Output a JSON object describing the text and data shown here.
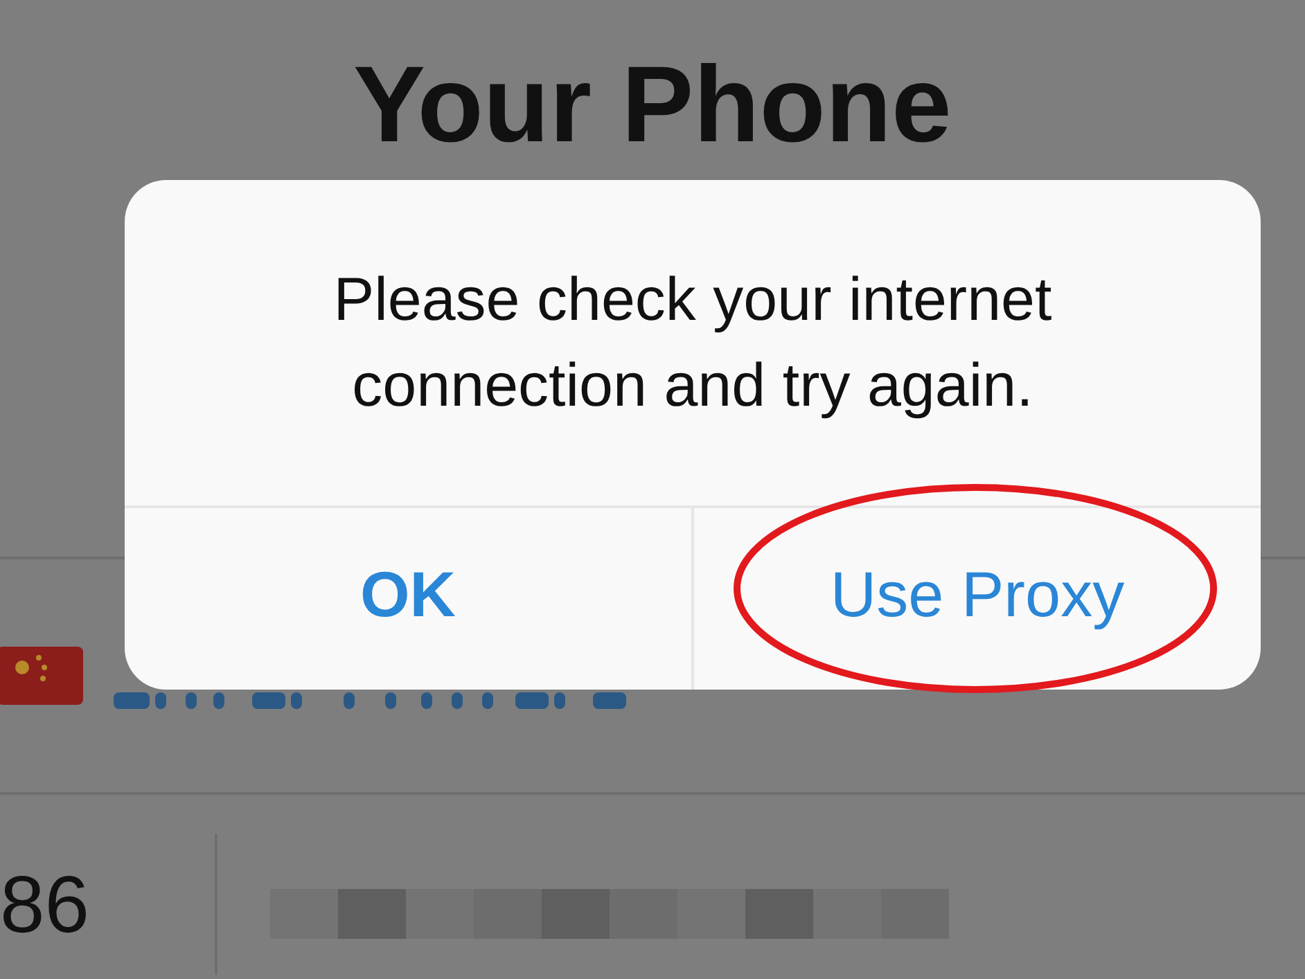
{
  "screen": {
    "title": "Your Phone",
    "phone": {
      "code": "86"
    }
  },
  "alert": {
    "message": "Please check your internet connection and try again.",
    "buttons": [
      {
        "label": "OK",
        "kind": "default"
      },
      {
        "label": "Use Proxy",
        "kind": "normal"
      }
    ],
    "annotation": {
      "kind": "ellipse"
    }
  }
}
